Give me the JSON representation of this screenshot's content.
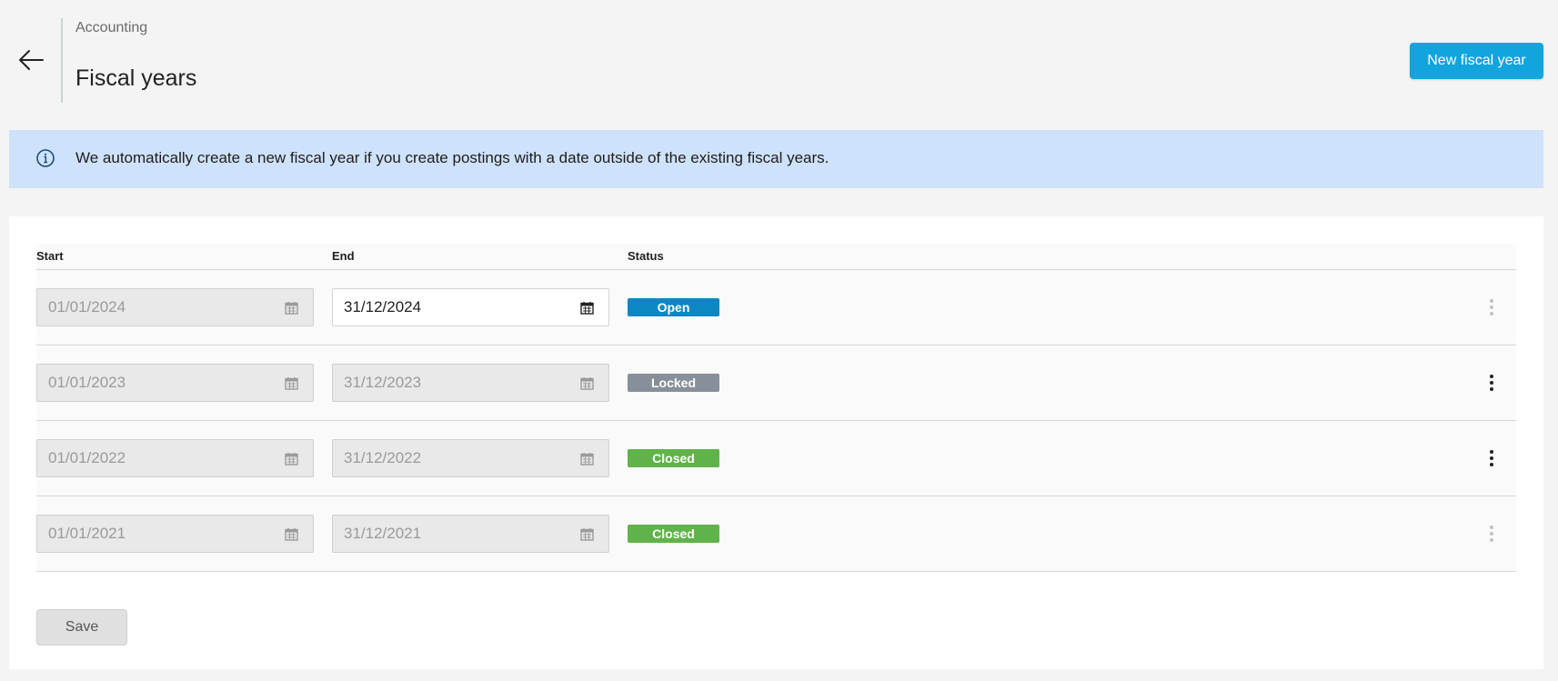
{
  "header": {
    "breadcrumb": "Accounting",
    "title": "Fiscal years",
    "new_button_label": "New fiscal year"
  },
  "info": {
    "text": "We automatically create a new fiscal year if you create postings with a date outside of the existing fiscal years."
  },
  "table": {
    "columns": [
      "Start",
      "End",
      "Status"
    ],
    "rows": [
      {
        "start": "01/01/2024",
        "end": "31/12/2024",
        "status": "Open",
        "status_color": "#0c87c4",
        "end_editable": true,
        "menu_enabled": false
      },
      {
        "start": "01/01/2023",
        "end": "31/12/2023",
        "status": "Locked",
        "status_color": "#87909a",
        "end_editable": false,
        "menu_enabled": true
      },
      {
        "start": "01/01/2022",
        "end": "31/12/2022",
        "status": "Closed",
        "status_color": "#60b34a",
        "end_editable": false,
        "menu_enabled": true
      },
      {
        "start": "01/01/2021",
        "end": "31/12/2021",
        "status": "Closed",
        "status_color": "#60b34a",
        "end_editable": false,
        "menu_enabled": false
      }
    ]
  },
  "footer": {
    "save_label": "Save"
  },
  "icons": {
    "back": "arrow-left-icon",
    "info": "info-circle-icon",
    "calendar": "calendar-icon",
    "menu": "more-vertical-icon"
  },
  "colors": {
    "accent": "#12a4dc",
    "info_bg": "#cfe2fb",
    "page_bg": "#f4f4f4"
  }
}
